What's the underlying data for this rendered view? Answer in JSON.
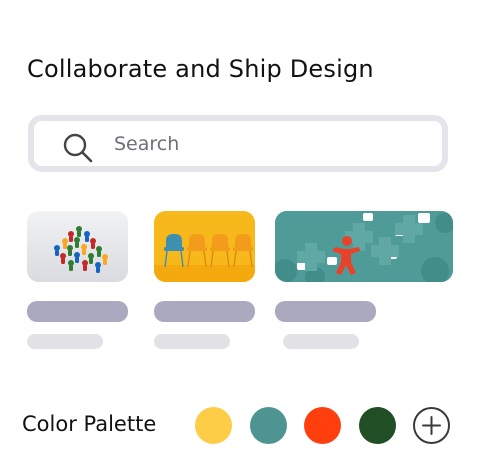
{
  "header": {
    "title": "Collaborate and Ship Design"
  },
  "search": {
    "placeholder": "Search",
    "value": "",
    "icon": "search-icon"
  },
  "cards": [
    {
      "image": "game-pieces-crowd-photo"
    },
    {
      "image": "yellow-chairs-photo"
    },
    {
      "image": "puzzle-gears-people-photo"
    }
  ],
  "palette": {
    "label": "Color Palette",
    "colors": [
      "#FDCD47",
      "#4E9493",
      "#FF3F0E",
      "#214F25"
    ],
    "add_icon": "plus-icon"
  }
}
